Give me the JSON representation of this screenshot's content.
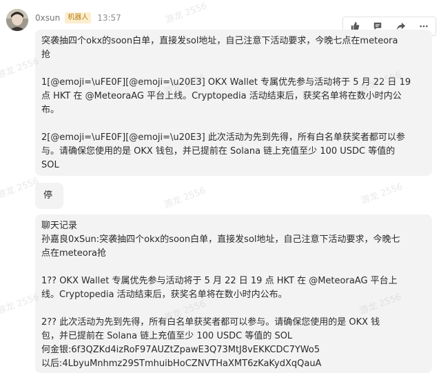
{
  "message": {
    "sender": "0xsun",
    "badge": "机器人",
    "time": "13:57"
  },
  "actions": [
    {
      "name": "thumbs-up-icon"
    },
    {
      "name": "comment-icon"
    },
    {
      "name": "forward-icon"
    },
    {
      "name": "more-icon"
    }
  ],
  "bubble1": {
    "lines": [
      "突袭抽四个okx的soon白单，直接发sol地址，自己注意下活动要求，今晚七点在meteora",
      "抢",
      "",
      "1[@emoji=\\uFE0F][@emoji=\\u20E3] OKX Wallet 专属优先参与活动将于 5 月 22 日 19",
      "点 HKT 在 @MeteoraAG 平台上线。Cryptopedia 活动结束后，获奖名单将在数小时内公",
      "布。",
      "",
      "2[@emoji=\\uFE0F][@emoji=\\u20E3] 此次活动为先到先得，所有白名单获奖者都可以参",
      "与。请确保您使用的是 OKX 钱包，并已提前在 Solana 链上充值至少 100 USDC 等值的",
      "SOL"
    ]
  },
  "bubble2": {
    "text": "停"
  },
  "bubble3": {
    "lines": [
      "聊天记录",
      "孙嘉良0xSun:突袭抽四个okx的soon白单，直接发sol地址，自己注意下活动要求，今晚七",
      "点在meteora抢",
      "",
      "1?? OKX Wallet 专属优先参与活动将于 5 月 22 日 19 点 HKT 在 @MeteoraAG 平台上",
      "线。Cryptopedia 活动结束后，获奖名单将在数小时内公布。",
      "",
      "2?? 此次活动为先到先得，所有白名单获奖者都可以参与。请确保您使用的是 OKX 钱",
      "包，并已提前在 Solana 链上充值至少 100 USDC 等值的 SOL",
      "何金银:6f3QZKd4izRoF97AUZtZpawE3Q73MtJ8vEKKCDC7YWo5",
      "以后:4LbyuMnhmz29STmhuibHoCZNVTHaXMT6zKaKydXqQauA"
    ]
  },
  "watermark": "游龙 2556"
}
